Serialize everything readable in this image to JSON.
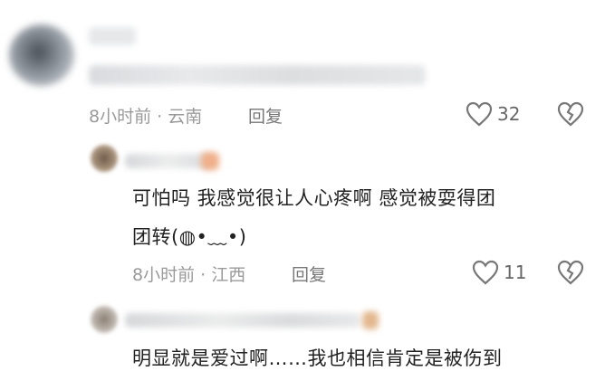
{
  "comments": [
    {
      "meta": "8小时前 · 云南",
      "reply_label": "回复",
      "likes": "32"
    },
    {
      "lines": [
        "可怕吗 我感觉很让人心疼啊 感觉被耍得团",
        "团转(◍•﹏•)"
      ],
      "meta": "8小时前 · 江西",
      "reply_label": "回复",
      "likes": "11"
    },
    {
      "lines": [
        "明显就是爱过啊……我也相信肯定是被伤到"
      ]
    }
  ]
}
